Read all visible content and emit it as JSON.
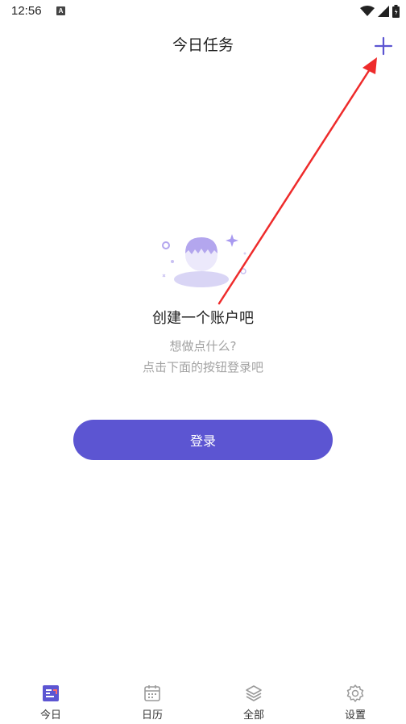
{
  "status_bar": {
    "time": "12:56",
    "notification_letter": "A"
  },
  "header": {
    "title": "今日任务",
    "add_icon": "plus-icon"
  },
  "empty_state": {
    "title": "创建一个账户吧",
    "subtitle_line1": "想做点什么?",
    "subtitle_line2": "点击下面的按钮登录吧",
    "illustration": "user-avatar-illustration"
  },
  "login_button": {
    "label": "登录"
  },
  "bottom_nav": {
    "items": [
      {
        "label": "今日",
        "icon": "today-icon",
        "active": true
      },
      {
        "label": "日历",
        "icon": "calendar-icon",
        "active": false
      },
      {
        "label": "全部",
        "icon": "layers-icon",
        "active": false
      },
      {
        "label": "设置",
        "icon": "gear-icon",
        "active": false
      }
    ]
  },
  "colors": {
    "accent": "#5c55d2",
    "annotation_arrow": "#ee2b2b",
    "muted_text": "#a2a2a2"
  }
}
